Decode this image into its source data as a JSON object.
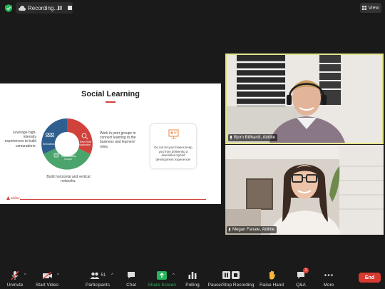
{
  "topbar": {
    "recording_label": "Recording...",
    "view_label": "View"
  },
  "slide": {
    "title": "Social Learning",
    "left_text": "Leverage high-intensity experiences to build camaraderie.",
    "right_text": "Work in peer groups to connect learning to the business and learners' roles.",
    "bottom_text": "Build horizontal and vertical networks.",
    "segments": [
      "Simulations",
      "Real World Application",
      "Accountability Groups"
    ],
    "callout_text": "Do not let your biases keep you from delivering a diversified hybrid development experience!",
    "logo_text": "abilitie",
    "colors": {
      "blue": "#2f5f8f",
      "red": "#d0423b",
      "green": "#4aa46c"
    }
  },
  "participants": [
    {
      "name": "Bjorn Billhardt, Abilitie",
      "mic": "unmuted"
    },
    {
      "name": "Megan Fanale, Abilitie",
      "mic": "unmuted"
    }
  ],
  "toolbar": {
    "unmute": "Unmute",
    "start_video": "Start Video",
    "participants": "Participants",
    "participants_count": "51",
    "chat": "Chat",
    "share_screen": "Share Screen",
    "polling": "Polling",
    "pause_stop_recording": "Pause/Stop Recording",
    "raise_hand": "Raise Hand",
    "qa": "Q&A",
    "qa_badge": "1",
    "more": "More",
    "end": "End"
  }
}
